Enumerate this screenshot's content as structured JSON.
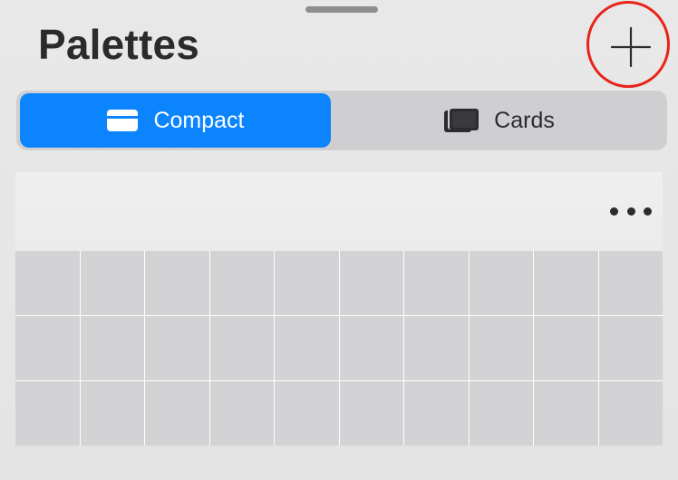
{
  "header": {
    "title": "Palettes",
    "add_icon": "plus-icon"
  },
  "view_mode": {
    "selected": "Compact",
    "options": [
      {
        "label": "Compact",
        "icon": "card-icon"
      },
      {
        "label": "Cards",
        "icon": "stacked-cards-icon"
      }
    ]
  },
  "palette": {
    "more_icon": "ellipsis-icon",
    "swatch_rows": 3,
    "swatch_columns": 10,
    "swatch_color": "#d3d3d5"
  },
  "colors": {
    "accent": "#0b84fe",
    "highlight": "#e8231a",
    "title_text": "#2b2b2d"
  }
}
